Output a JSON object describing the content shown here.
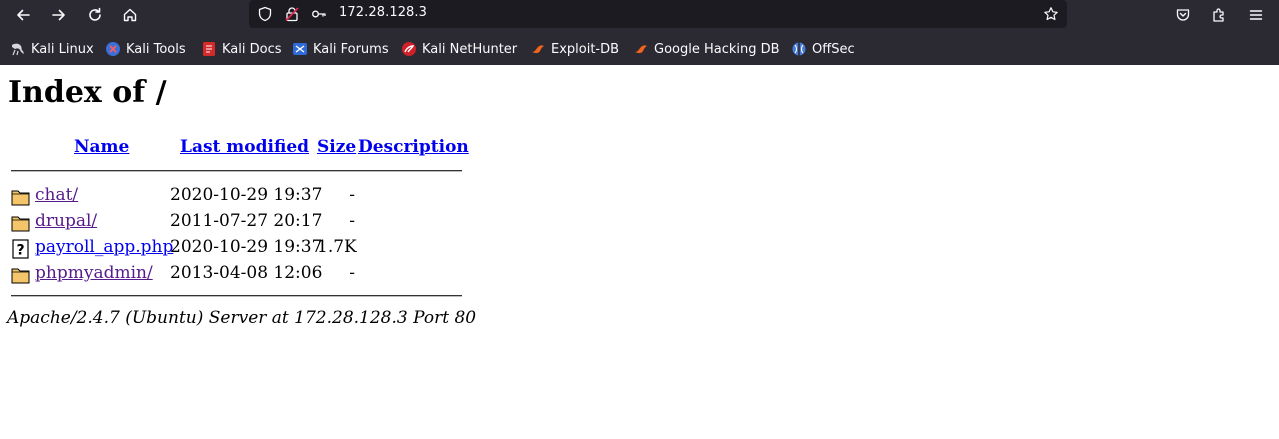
{
  "browser": {
    "url": "172.28.128.3",
    "bookmarks": [
      {
        "label": "Kali Linux",
        "icon": "kali-dragon-icon"
      },
      {
        "label": "Kali Tools",
        "icon": "kali-tools-icon"
      },
      {
        "label": "Kali Docs",
        "icon": "kali-docs-icon"
      },
      {
        "label": "Kali Forums",
        "icon": "kali-forums-icon"
      },
      {
        "label": "Kali NetHunter",
        "icon": "kali-nethunter-icon"
      },
      {
        "label": "Exploit-DB",
        "icon": "exploit-db-icon"
      },
      {
        "label": "Google Hacking DB",
        "icon": "ghdb-icon"
      },
      {
        "label": "OffSec",
        "icon": "offsec-icon"
      }
    ],
    "colors": {
      "chrome_bg": "#2b2a33",
      "urlbar_bg": "#1c1b22",
      "text": "#fbfbfe"
    }
  },
  "page": {
    "title": "Index of /",
    "columns": {
      "name": "Name",
      "last_modified": "Last modified",
      "size": "Size",
      "description": "Description"
    },
    "entries": [
      {
        "icon": "folder-icon",
        "name": "chat/",
        "modified": "2020-10-29 19:37",
        "size": "-",
        "description": ""
      },
      {
        "icon": "folder-icon",
        "name": "drupal/",
        "modified": "2011-07-27 20:17",
        "size": "-",
        "description": ""
      },
      {
        "icon": "unknown-file-icon",
        "name": "payroll_app.php",
        "modified": "2020-10-29 19:37",
        "size": "1.7K",
        "description": ""
      },
      {
        "icon": "folder-icon",
        "name": "phpmyadmin/",
        "modified": "2013-04-08 12:06",
        "size": "-",
        "description": ""
      }
    ],
    "server_signature": "Apache/2.4.7 (Ubuntu) Server at 172.28.128.3 Port 80",
    "colors": {
      "link": "#0000ee",
      "visited": "#551a8b"
    }
  }
}
